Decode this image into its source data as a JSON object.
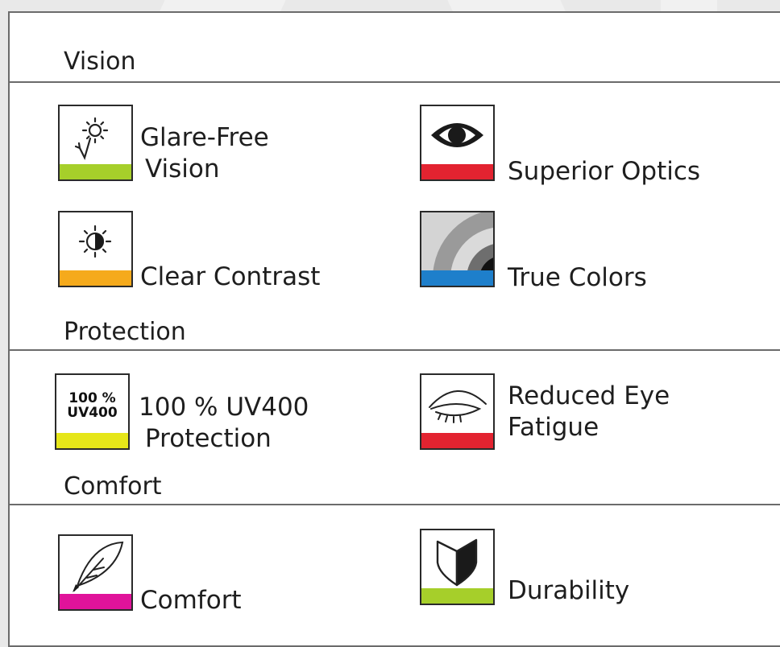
{
  "sections": {
    "vision": "Vision",
    "protection": "Protection",
    "comfort": "Comfort"
  },
  "features": {
    "glare_free": {
      "line1": "Glare-Free",
      "line2": "Vision",
      "icon": "sun-check-icon",
      "bar_color": "#a6cf2a"
    },
    "superior_optics": {
      "label": "Superior Optics",
      "icon": "eye-icon",
      "bar_color": "#e32330"
    },
    "clear_contrast": {
      "label": "Clear Contrast",
      "icon": "contrast-sun-icon",
      "bar_color": "#f5aa1c"
    },
    "true_colors": {
      "label": "True Colors",
      "icon": "color-rings-icon",
      "bar_color": "#1e7fcb"
    },
    "uv400": {
      "line1": "100 % UV400",
      "line2": "Protection",
      "icon_line1": "100 %",
      "icon_line2": "UV400",
      "icon": "uv400-badge-icon",
      "bar_color": "#e6e619"
    },
    "reduced_fatigue": {
      "line1": "Reduced Eye",
      "line2": "Fatigue",
      "icon": "closed-eye-icon",
      "bar_color": "#e32330"
    },
    "comfort": {
      "label": "Comfort",
      "icon": "feather-icon",
      "bar_color": "#e0139a"
    },
    "durability": {
      "label": "Durability",
      "icon": "shield-icon",
      "bar_color": "#a6cf2a"
    }
  }
}
